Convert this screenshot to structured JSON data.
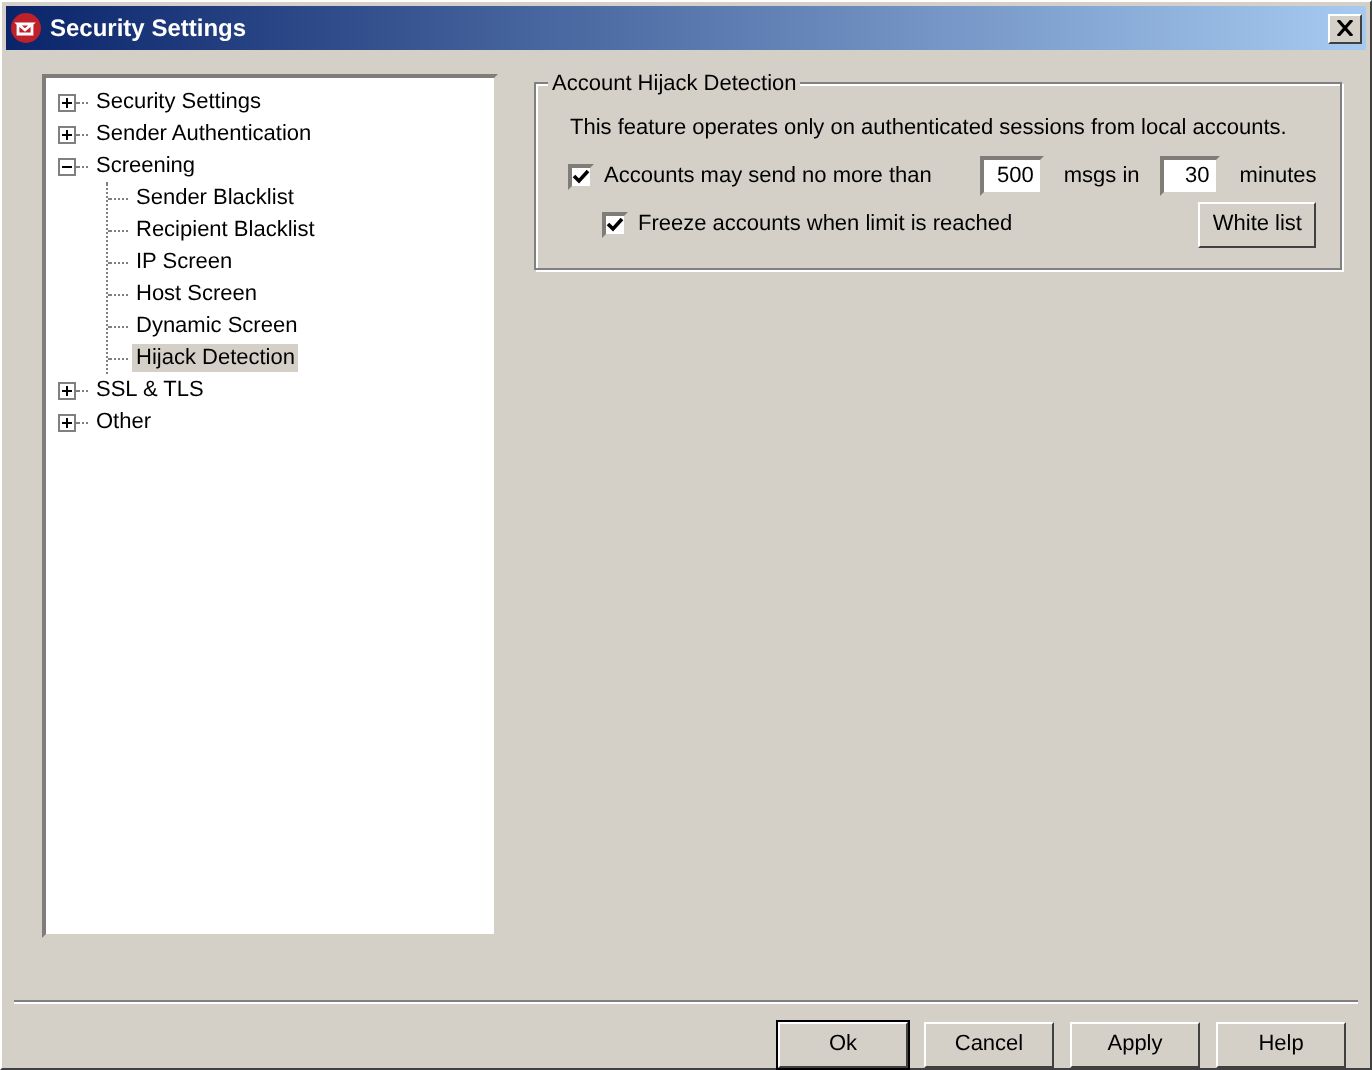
{
  "window": {
    "title": "Security Settings"
  },
  "tree": [
    {
      "label": "Security Settings",
      "expanded": false,
      "selected": false
    },
    {
      "label": "Sender Authentication",
      "expanded": false,
      "selected": false
    },
    {
      "label": "Screening",
      "expanded": true,
      "selected": false,
      "children": [
        {
          "label": "Sender Blacklist",
          "selected": false
        },
        {
          "label": "Recipient Blacklist",
          "selected": false
        },
        {
          "label": "IP Screen",
          "selected": false
        },
        {
          "label": "Host Screen",
          "selected": false
        },
        {
          "label": "Dynamic Screen",
          "selected": false
        },
        {
          "label": "Hijack Detection",
          "selected": true
        }
      ]
    },
    {
      "label": "SSL & TLS",
      "expanded": false,
      "selected": false
    },
    {
      "label": "Other",
      "expanded": false,
      "selected": false
    }
  ],
  "group": {
    "title": "Account Hijack Detection",
    "note": "This feature operates only on authenticated sessions from local accounts.",
    "limit": {
      "label": "Accounts may send no more than",
      "checked": true,
      "count": "500",
      "count_unit": "msgs in",
      "minutes": "30",
      "minutes_unit": "minutes"
    },
    "freeze": {
      "label": "Freeze accounts when limit is reached",
      "checked": true
    },
    "white_list_button": "White list"
  },
  "buttons": [
    {
      "label": "Ok",
      "default": true
    },
    {
      "label": "Cancel",
      "default": false
    },
    {
      "label": "Apply",
      "default": false
    },
    {
      "label": "Help",
      "default": false
    }
  ]
}
